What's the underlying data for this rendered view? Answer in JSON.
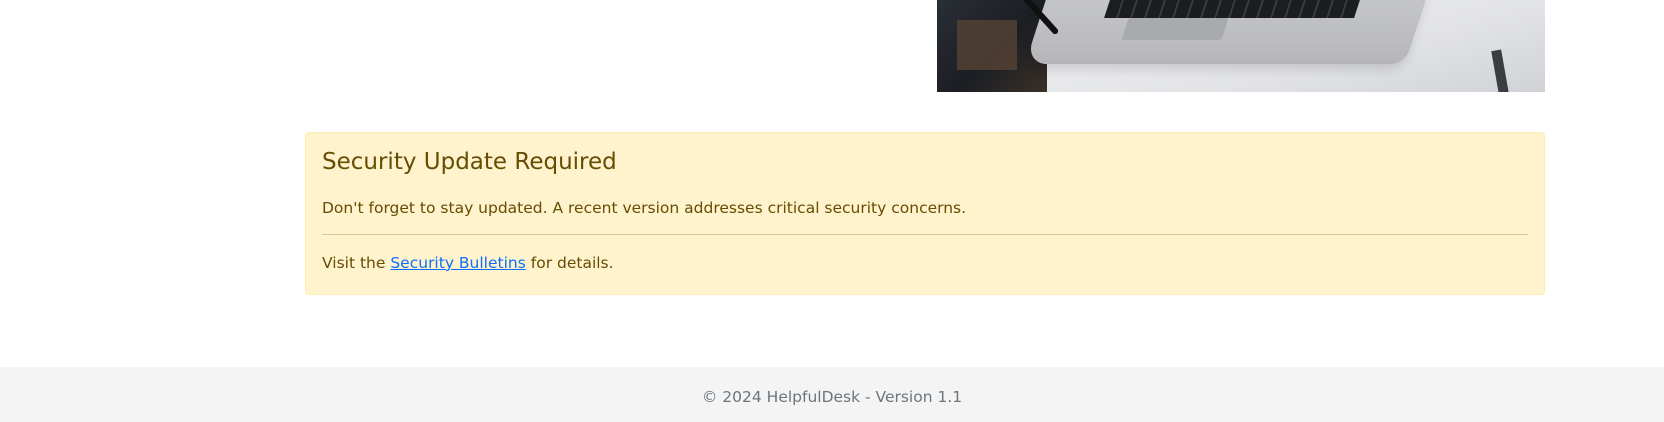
{
  "alert": {
    "heading": "Security Update Required",
    "message": "Don't forget to stay updated. A recent version addresses critical security concerns.",
    "footer_prefix": "Visit the",
    "link_text": "Security Bulletins",
    "footer_suffix": "for details."
  },
  "footer": {
    "copyright": "© 2024 HelpfulDesk - Version 1.1"
  },
  "colors": {
    "alert_background": "#fff3cd",
    "alert_text": "#664d03",
    "link": "#0d6efd",
    "footer_background": "#f4f4f4",
    "footer_text": "#6c757d"
  }
}
